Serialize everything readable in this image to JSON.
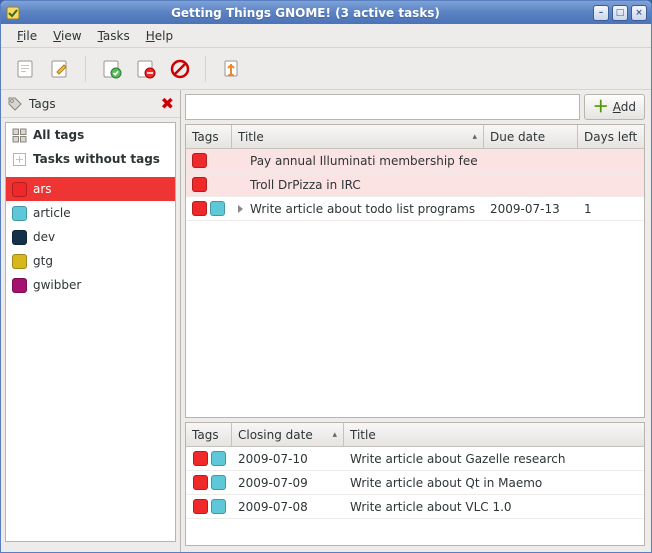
{
  "window_title": "Getting Things GNOME! (3 active tasks)",
  "menus": {
    "file": "File",
    "view": "View",
    "tasks": "Tasks",
    "help": "Help"
  },
  "sidebar": {
    "header_label": "Tags",
    "all_tags": "All tags",
    "no_tags": "Tasks without tags",
    "items": [
      {
        "label": "ars",
        "color": "#ef2929",
        "selected": true
      },
      {
        "label": "article",
        "color": "#5ec8d8"
      },
      {
        "label": "dev",
        "color": "#15304a"
      },
      {
        "label": "gtg",
        "color": "#d6b71d"
      },
      {
        "label": "gwibber",
        "color": "#a4116f"
      }
    ]
  },
  "search": {
    "value": "",
    "placeholder": ""
  },
  "add_button": "Add",
  "columns": {
    "tags": "Tags",
    "title": "Title",
    "due": "Due date",
    "days": "Days left",
    "closing": "Closing date"
  },
  "active_tasks": [
    {
      "tags": [
        "#ef2929"
      ],
      "title": "Pay annual Illuminati membership fee",
      "due": "",
      "days": "",
      "overdue": true
    },
    {
      "tags": [
        "#ef2929"
      ],
      "title": "Troll DrPizza in IRC",
      "due": "",
      "days": "",
      "overdue": true
    },
    {
      "tags": [
        "#ef2929",
        "#5ec8d8"
      ],
      "title": "Write article about todo list programs",
      "due": "2009-07-13",
      "days": "1",
      "expandable": true
    }
  ],
  "closed_tasks": [
    {
      "tags": [
        "#ef2929",
        "#5ec8d8"
      ],
      "closing": "2009-07-10",
      "title": "Write article about Gazelle research"
    },
    {
      "tags": [
        "#ef2929",
        "#5ec8d8"
      ],
      "closing": "2009-07-09",
      "title": "Write article about Qt in Maemo"
    },
    {
      "tags": [
        "#ef2929",
        "#5ec8d8"
      ],
      "closing": "2009-07-08",
      "title": "Write article about VLC 1.0"
    }
  ]
}
